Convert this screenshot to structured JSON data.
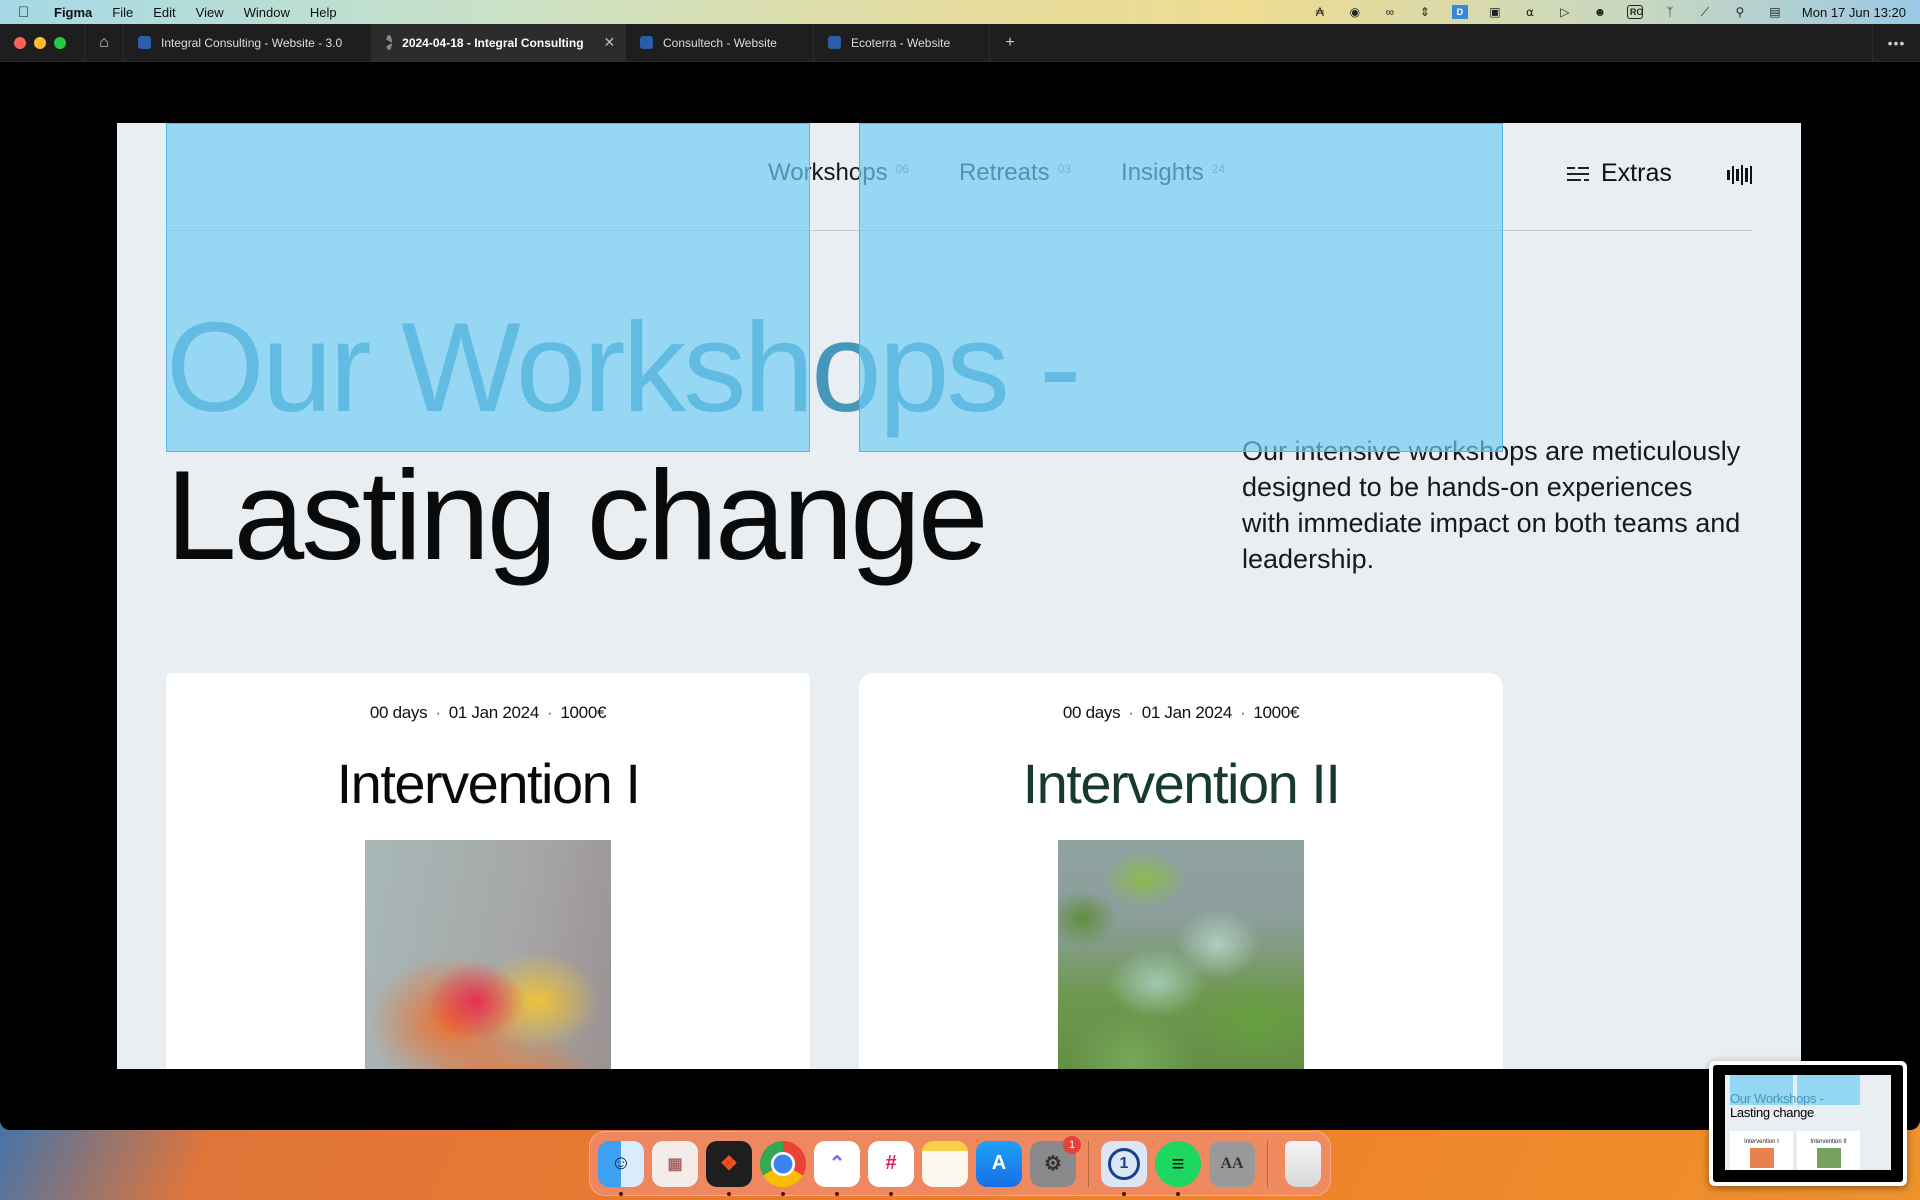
{
  "menubar": {
    "app_name": "Figma",
    "menus": [
      "File",
      "Edit",
      "View",
      "Window",
      "Help"
    ],
    "tray_icons": [
      "figma-icon",
      "screen-lock-icon",
      "creative-cloud-icon",
      "arrows-icon",
      "docs-icon",
      "clapper-icon",
      "headphones-icon",
      "play-icon",
      "user-icon",
      "input-source-icon",
      "bluetooth-icon",
      "wifi-off-icon",
      "search-icon",
      "control-center-icon"
    ],
    "input_source": "RO",
    "clock": "Mon 17 Jun  13:20"
  },
  "tabs": [
    {
      "label": "Integral Consulting - Website - 3.0",
      "icon": "figma-file-icon",
      "active": false
    },
    {
      "label": "2024-04-18 - Integral Consulting",
      "icon": "presentation-play-icon",
      "active": true
    },
    {
      "label": "Consultech - Website",
      "icon": "figma-file-icon",
      "active": false
    },
    {
      "label": "Ecoterra - Website",
      "icon": "figma-file-icon",
      "active": false
    }
  ],
  "tab_add_label": "+",
  "more_label": "•••",
  "slide": {
    "nav": [
      {
        "label": "Workshops",
        "count": "06"
      },
      {
        "label": "Retreats",
        "count": "03"
      },
      {
        "label": "Insights",
        "count": "24"
      }
    ],
    "extras_label": "Extras",
    "hero_line1": "Our Workshops -",
    "hero_line2": "Lasting change",
    "intro": "Our intensive workshops are meticulously designed to be hands-on experiences with immediate impact on both teams and leadership.",
    "cards": [
      {
        "duration": "00 days",
        "date": "01 Jan 2024",
        "price": "1000€",
        "title": "Intervention I",
        "image": "abstract-orange-sculpture-image"
      },
      {
        "duration": "00 days",
        "date": "01 Jan 2024",
        "price": "1000€",
        "title": "Intervention II",
        "image": "green-foliage-crystal-image"
      }
    ]
  },
  "dock": {
    "apps": [
      {
        "name": "Finder",
        "running": true
      },
      {
        "name": "Launchpad",
        "running": false
      },
      {
        "name": "Figma",
        "running": true
      },
      {
        "name": "Chrome",
        "running": true
      },
      {
        "name": "ClickUp",
        "running": true
      },
      {
        "name": "Slack",
        "running": true
      },
      {
        "name": "Notes",
        "running": false
      },
      {
        "name": "App Store",
        "running": false
      },
      {
        "name": "System Settings",
        "running": false,
        "badge": "1"
      },
      {
        "name": "1Password",
        "running": true
      },
      {
        "name": "Spotify",
        "running": true
      },
      {
        "name": "Font Book",
        "running": false
      },
      {
        "name": "Trash",
        "running": false
      }
    ],
    "font_book_glyph": "AA",
    "onepassword_glyph": "1"
  },
  "thumbnail": {
    "hero_line1": "Our Workshops -",
    "hero_line2": "Lasting change",
    "card1": "Intervention I",
    "card2": "Intervention II"
  }
}
